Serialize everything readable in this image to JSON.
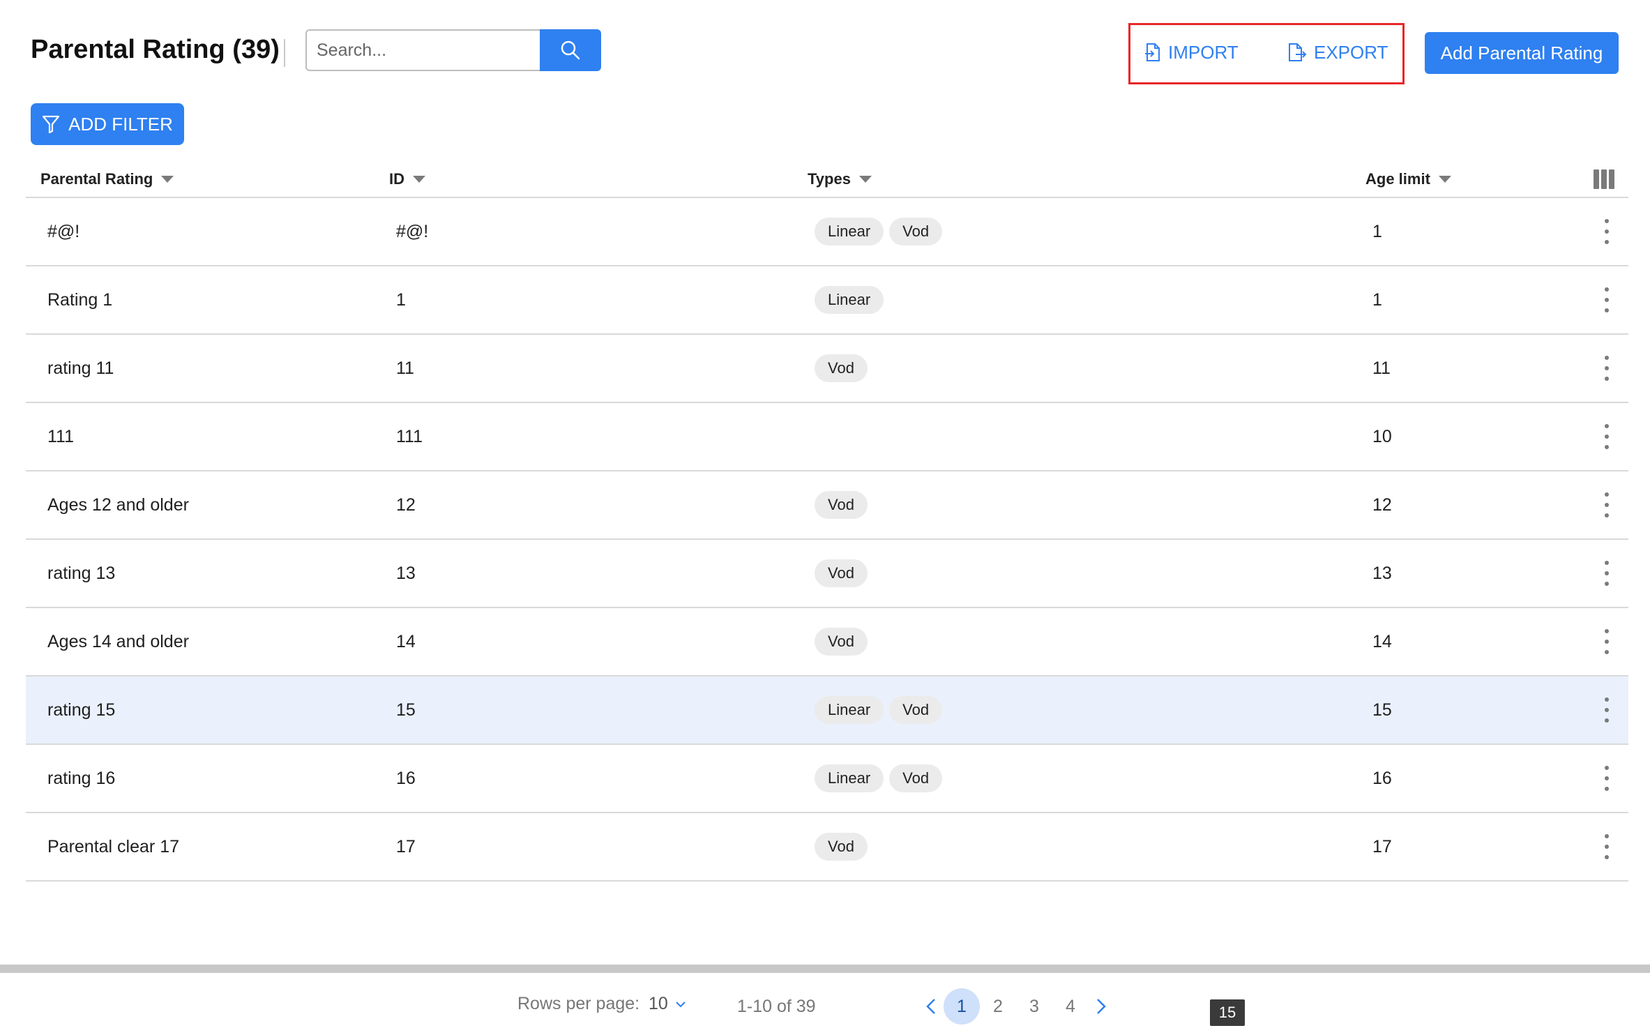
{
  "header": {
    "title": "Parental Rating (39)",
    "search_placeholder": "Search...",
    "import_label": "IMPORT",
    "export_label": "EXPORT",
    "add_label": "Add Parental Rating",
    "filter_label": "ADD FILTER"
  },
  "colors": {
    "accent": "#2f80f0",
    "highlight_box": "#e8272b",
    "row_highlight": "#eaf1fc"
  },
  "table": {
    "columns": [
      "Parental Rating",
      "ID",
      "Types",
      "Age limit"
    ],
    "rows": [
      {
        "name": "#@!",
        "id": "#@!",
        "types": [
          "Linear",
          "Vod"
        ],
        "age": "1"
      },
      {
        "name": "Rating 1",
        "id": "1",
        "types": [
          "Linear"
        ],
        "age": "1"
      },
      {
        "name": "rating 11",
        "id": "11",
        "types": [
          "Vod"
        ],
        "age": "11"
      },
      {
        "name": "111",
        "id": "111",
        "types": [],
        "age": "10"
      },
      {
        "name": "Ages 12 and older",
        "id": "12",
        "types": [
          "Vod"
        ],
        "age": "12"
      },
      {
        "name": "rating 13",
        "id": "13",
        "types": [
          "Vod"
        ],
        "age": "13"
      },
      {
        "name": "Ages 14 and older",
        "id": "14",
        "types": [
          "Vod"
        ],
        "age": "14"
      },
      {
        "name": "rating 15",
        "id": "15",
        "types": [
          "Linear",
          "Vod"
        ],
        "age": "15",
        "highlighted": true
      },
      {
        "name": "rating 16",
        "id": "16",
        "types": [
          "Linear",
          "Vod"
        ],
        "age": "16"
      },
      {
        "name": "Parental clear 17",
        "id": "17",
        "types": [
          "Vod"
        ],
        "age": "17"
      }
    ]
  },
  "footer": {
    "rows_per_page_label": "Rows per page:",
    "rows_per_page_value": "10",
    "range": "1-10 of 39",
    "pages": [
      "1",
      "2",
      "3",
      "4"
    ],
    "active_page": "1",
    "tooltip": "15"
  }
}
